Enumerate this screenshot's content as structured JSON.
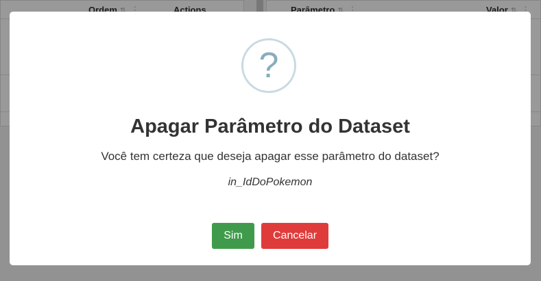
{
  "background": {
    "left_table": {
      "columns": [
        "Ordem",
        "Actions"
      ]
    },
    "right_table": {
      "columns": [
        "Parâmetro",
        "Valor"
      ]
    }
  },
  "dialog": {
    "icon": "question-icon",
    "icon_glyph": "?",
    "title": "Apagar Parâmetro do Dataset",
    "message": "Você tem certeza que deseja apagar esse parâmetro do dataset?",
    "parameter_name": "in_IdDoPokemon",
    "confirm_label": "Sim",
    "cancel_label": "Cancelar"
  },
  "colors": {
    "confirm": "#3f9b4b",
    "cancel": "#e03b3b",
    "icon": "#87adbd",
    "icon_ring": "#c9dae1"
  }
}
